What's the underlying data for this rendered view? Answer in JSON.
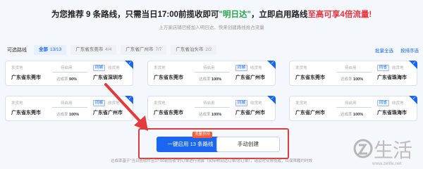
{
  "header": {
    "headline_prefix": "为您推荐 9 条路线，只需当日17:00前揽收即可",
    "headline_green": "\"明日达\"",
    "headline_mid": "，立即启用路线",
    "headline_red": "至高可享4倍流量!",
    "subline": "上万家店铺已经加入明日达，快来创建路线抢占流量"
  },
  "filter": {
    "label": "可选路线",
    "tabs": [
      {
        "name": "全部",
        "count": "13/13"
      },
      {
        "name": "广东省东莞市",
        "count": "4/4"
      },
      {
        "name": "广东省广州市",
        "count": "7/7"
      },
      {
        "name": "广东省汕头市",
        "count": "2/2"
      }
    ],
    "select_all": "批量全选",
    "sort": "按排序选"
  },
  "card_labels": {
    "origin_label": "发货地",
    "transit_label": "待启用",
    "dest_label": "收货地",
    "rate_label": "达成率"
  },
  "routes": [
    {
      "origin": "广东省东莞市",
      "badge": "同城",
      "dest": "广东省深圳市",
      "rate": "90%"
    },
    {
      "origin": "广东省东莞市",
      "badge": "同城",
      "dest": "广东省广州市",
      "rate": "100%"
    },
    {
      "origin": "广东省东莞市",
      "badge": "同省",
      "dest": "广东省珠海市",
      "rate": "100%"
    },
    {
      "origin": "广东省东莞市",
      "badge": "同城",
      "dest": "广东省广州市",
      "rate": "100%"
    },
    {
      "origin": "广东省东莞市",
      "badge": "同城",
      "dest": "广东省广州市",
      "rate": "100%"
    },
    {
      "origin": "广东省广州市",
      "badge": "同省",
      "dest": "广东省珠海市",
      "rate": "100%"
    }
  ],
  "actions": {
    "promo_tag": "流量扶持",
    "primary": "一键启用 13 条路线",
    "secondary": "手动创建"
  },
  "footnote": "达成率基于\"当日揽收件且17:00前揽收\"的订单进行测算（实际明日达订单/总订单），请及时安排揽收，以保障履约时效",
  "watermark": {
    "text": "生活",
    "url": "www.zelife.net"
  },
  "colors": {
    "accent": "#1a66f0",
    "highlight": "#e23b3b",
    "green": "#2aa24a",
    "red": "#e8333b"
  }
}
